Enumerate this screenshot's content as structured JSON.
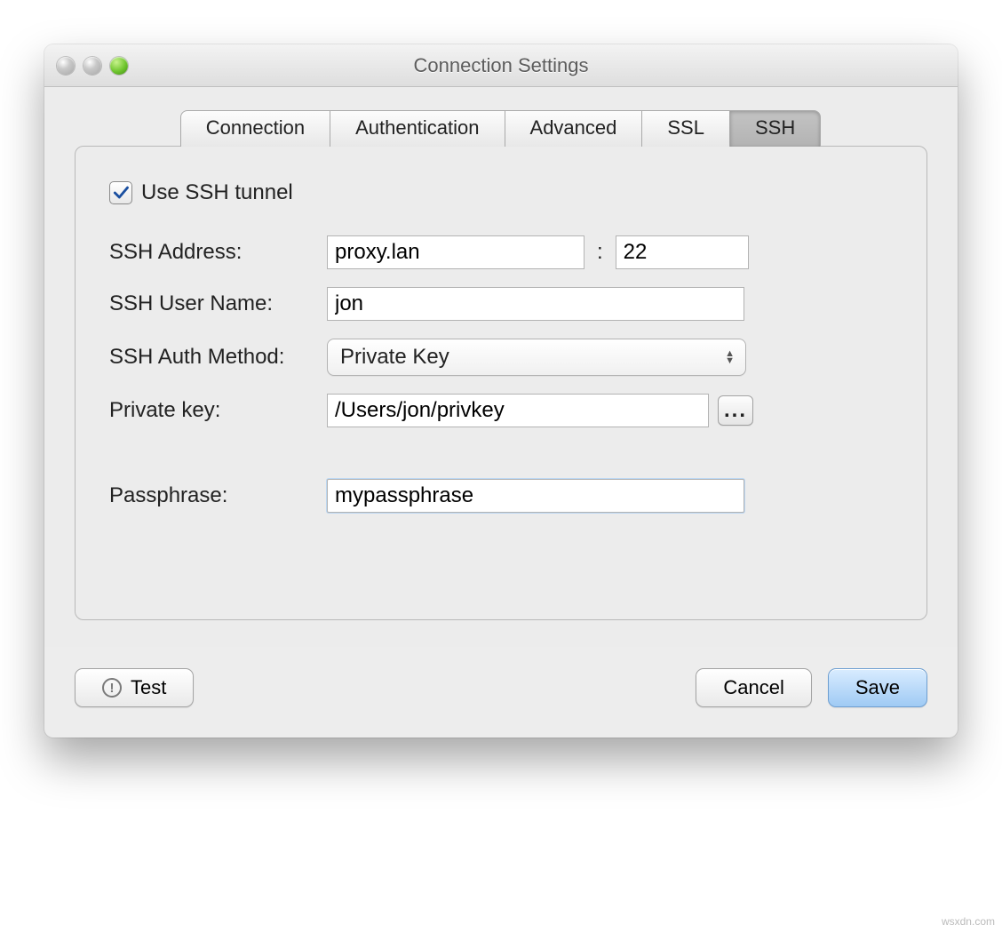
{
  "window": {
    "title": "Connection Settings"
  },
  "tabs": [
    {
      "label": "Connection"
    },
    {
      "label": "Authentication"
    },
    {
      "label": "Advanced"
    },
    {
      "label": "SSL"
    },
    {
      "label": "SSH"
    }
  ],
  "ssh": {
    "use_tunnel_label": "Use SSH tunnel",
    "use_tunnel_checked": true,
    "address_label": "SSH Address:",
    "address_value": "proxy.lan",
    "port_value": "22",
    "username_label": "SSH User Name:",
    "username_value": "jon",
    "auth_method_label": "SSH Auth Method:",
    "auth_method_value": "Private Key",
    "private_key_label": "Private key:",
    "private_key_value": "/Users/jon/privkey",
    "browse_label": "...",
    "passphrase_label": "Passphrase:",
    "passphrase_value": "mypassphrase"
  },
  "buttons": {
    "test": "Test",
    "cancel": "Cancel",
    "save": "Save"
  },
  "watermark": "wsxdn.com"
}
